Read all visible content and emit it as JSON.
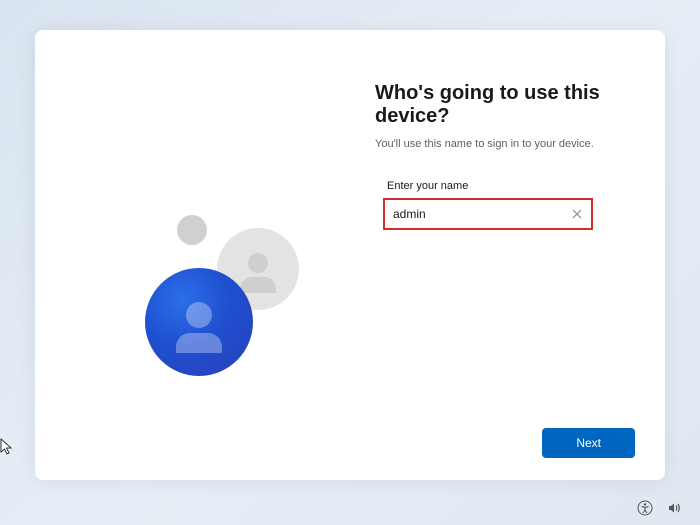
{
  "title": "Who's going to use this device?",
  "subtitle": "You'll use this name to sign in to your device.",
  "field_label": "Enter your name",
  "name_value": "admin",
  "next_label": "Next",
  "colors": {
    "accent": "#0067c0",
    "highlight_border": "#d02c2c"
  }
}
